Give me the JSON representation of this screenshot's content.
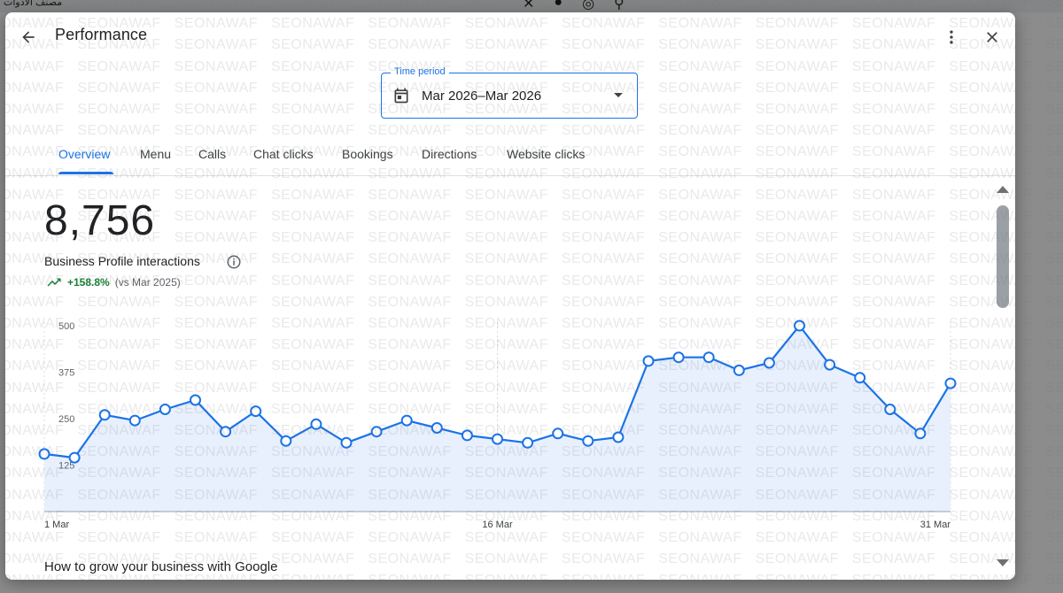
{
  "page": {
    "title": "Performance"
  },
  "header": {
    "back_icon": "arrow-back-icon",
    "more_icon": "more-vert-icon",
    "close_icon": "close-icon"
  },
  "time_period": {
    "label": "Time period",
    "value": "Mar 2026–Mar 2026",
    "icon": "calendar-icon"
  },
  "tabs": [
    {
      "label": "Overview",
      "active": true
    },
    {
      "label": "Menu",
      "active": false
    },
    {
      "label": "Calls",
      "active": false
    },
    {
      "label": "Chat clicks",
      "active": false
    },
    {
      "label": "Bookings",
      "active": false
    },
    {
      "label": "Directions",
      "active": false
    },
    {
      "label": "Website clicks",
      "active": false
    }
  ],
  "summary": {
    "total": "8,756",
    "label": "Business Profile interactions",
    "trend": "+158.8%",
    "comparison": "(vs Mar 2025)"
  },
  "chart_data": {
    "type": "area",
    "x": [
      "1 Mar",
      "2 Mar",
      "3 Mar",
      "4 Mar",
      "5 Mar",
      "6 Mar",
      "7 Mar",
      "8 Mar",
      "9 Mar",
      "10 Mar",
      "11 Mar",
      "12 Mar",
      "13 Mar",
      "14 Mar",
      "15 Mar",
      "16 Mar",
      "17 Mar",
      "18 Mar",
      "19 Mar",
      "20 Mar",
      "21 Mar",
      "22 Mar",
      "23 Mar",
      "24 Mar",
      "25 Mar",
      "26 Mar",
      "27 Mar",
      "28 Mar",
      "29 Mar",
      "30 Mar",
      "31 Mar"
    ],
    "series": [
      {
        "values": [
          155,
          145,
          260,
          245,
          275,
          300,
          215,
          270,
          190,
          235,
          185,
          215,
          245,
          225,
          205,
          195,
          185,
          210,
          190,
          200,
          405,
          415,
          415,
          380,
          400,
          500,
          395,
          360,
          275,
          210,
          345
        ]
      }
    ],
    "x_tick_labels": [
      "1 Mar",
      "16 Mar",
      "31 Mar"
    ],
    "y_tick_labels": [
      "125",
      "250",
      "375",
      "500"
    ],
    "yticks": [
      125,
      250,
      375,
      500
    ],
    "ylim": [
      0,
      500
    ],
    "grid": false,
    "line_color": "#1a73e8",
    "fill_color": "#e8f0fe"
  },
  "section": {
    "heading": "How to grow your business with Google"
  },
  "background": {
    "arabic_text": "مصنف الأدوات"
  },
  "watermark": {
    "text": "SEONAWAF"
  },
  "colors": {
    "accent": "#1a73e8",
    "positive": "#188038"
  }
}
